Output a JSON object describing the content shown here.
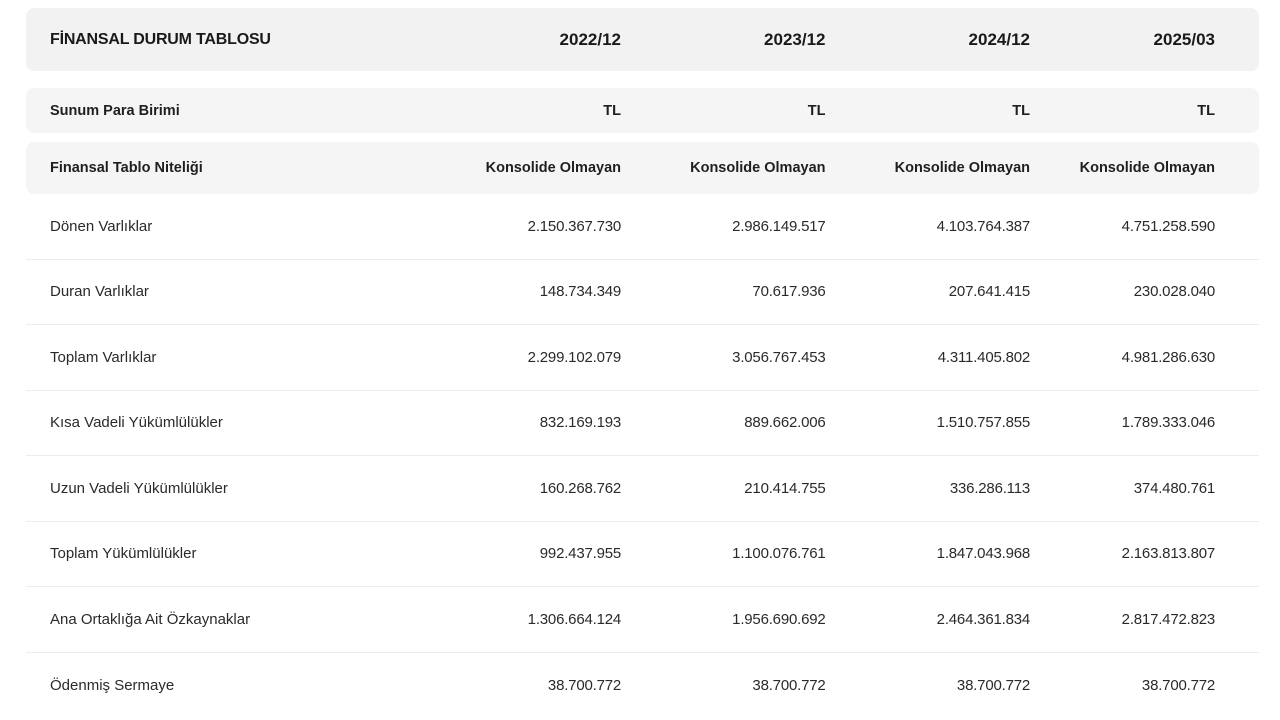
{
  "table": {
    "title": "FİNANSAL DURUM TABLOSU",
    "periods": [
      "2022/12",
      "2023/12",
      "2024/12",
      "2025/03"
    ],
    "meta_rows": [
      {
        "label": "Sunum Para Birimi",
        "values": [
          "TL",
          "TL",
          "TL",
          "TL"
        ]
      },
      {
        "label": "Finansal Tablo Niteliği",
        "values": [
          "Konsolide Olmayan",
          "Konsolide Olmayan",
          "Konsolide Olmayan",
          "Konsolide Olmayan"
        ]
      }
    ],
    "rows": [
      {
        "label": "Dönen Varlıklar",
        "values": [
          "2.150.367.730",
          "2.986.149.517",
          "4.103.764.387",
          "4.751.258.590"
        ]
      },
      {
        "label": "Duran Varlıklar",
        "values": [
          "148.734.349",
          "70.617.936",
          "207.641.415",
          "230.028.040"
        ]
      },
      {
        "label": "Toplam Varlıklar",
        "values": [
          "2.299.102.079",
          "3.056.767.453",
          "4.311.405.802",
          "4.981.286.630"
        ]
      },
      {
        "label": "Kısa Vadeli Yükümlülükler",
        "values": [
          "832.169.193",
          "889.662.006",
          "1.510.757.855",
          "1.789.333.046"
        ]
      },
      {
        "label": "Uzun Vadeli Yükümlülükler",
        "values": [
          "160.268.762",
          "210.414.755",
          "336.286.113",
          "374.480.761"
        ]
      },
      {
        "label": "Toplam Yükümlülükler",
        "values": [
          "992.437.955",
          "1.100.076.761",
          "1.847.043.968",
          "2.163.813.807"
        ]
      },
      {
        "label": "Ana Ortaklığa Ait Özkaynaklar",
        "values": [
          "1.306.664.124",
          "1.956.690.692",
          "2.464.361.834",
          "2.817.472.823"
        ]
      },
      {
        "label": "Ödenmiş Sermaye",
        "values": [
          "38.700.772",
          "38.700.772",
          "38.700.772",
          "38.700.772"
        ]
      }
    ]
  }
}
